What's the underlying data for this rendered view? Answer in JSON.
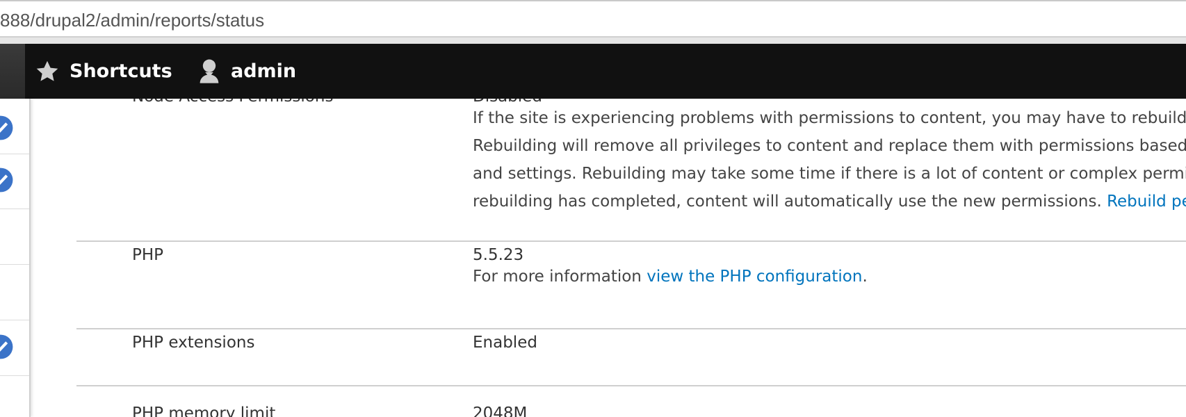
{
  "browser": {
    "url": "888/drupal2/admin/reports/status"
  },
  "toolbar": {
    "shortcuts_label": "Shortcuts",
    "user_label": "admin"
  },
  "status_rows": [
    {
      "label": "Node Access Permissions",
      "value": "Disabled",
      "description_lines": [
        "If the site is experiencing problems with permissions to content, you may have to rebuild the permissions cache.",
        "Rebuilding will remove all privileges to content and replace them with permissions based on the current modules",
        "and settings. Rebuilding may take some time if there is a lot of content or complex permission settings. After",
        "rebuilding has completed, content will automatically use the new permissions. "
      ],
      "description_link": "Rebuild permissions"
    },
    {
      "label": "PHP",
      "value": "5.5.23",
      "description_prefix": "For more information ",
      "description_link": "view the PHP configuration",
      "description_suffix": "."
    },
    {
      "label": "PHP extensions",
      "value": "Enabled"
    },
    {
      "label": "PHP memory limit",
      "value": "2048M"
    }
  ],
  "colors": {
    "toolbar_bg": "#111111",
    "link": "#0074bd",
    "check_icon": "#3b73c8"
  }
}
